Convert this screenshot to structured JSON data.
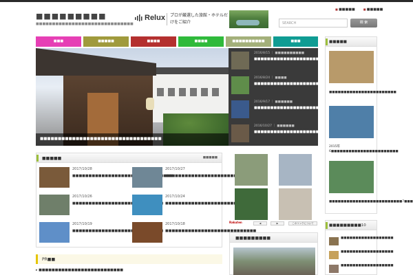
{
  "site": {
    "title": "■■■■■■■■■",
    "subtitle": "■■■■■■■■■■■■■■■■■■■■■■■■■■■■■■"
  },
  "banner": {
    "brand": "Relux",
    "tagline": "プロが厳選した旅館・ホテルだけをご紹介"
  },
  "toplinks": [
    "■■■■■",
    "■■■■■"
  ],
  "search": {
    "placeholder": "SEARCH",
    "button": "検 索"
  },
  "nav": [
    {
      "label": "■■■",
      "color": "#e63fb5"
    },
    {
      "label": "■■■■■",
      "color": "#a09a3c"
    },
    {
      "label": "■■■■",
      "color": "#b4302f"
    },
    {
      "label": "■■■■",
      "color": "#2fba3b"
    },
    {
      "label": "■■■■■■■■■■",
      "color": "#a3b07a"
    },
    {
      "label": "■■■",
      "color": "#0f9c93"
    }
  ],
  "hero": {
    "caption": "■■■■■■■■■■■■■■■■■■■■■■■■■■■■■■■■■■"
  },
  "slider": [
    {
      "meta": "2016/8/15 ｜ ■■■■■■■■■■",
      "title": "■■■■■■■■■■■■■■■■■■■■■■■■■■■■■■■■■",
      "color": "#6f6a55"
    },
    {
      "meta": "2016/8/24 ｜ ■■■■",
      "title": "■■■■■■■■■■■■■■■■■■■■■■■■■■■■■■■■■",
      "color": "#5f8d4a"
    },
    {
      "meta": "2016/9/17 ｜ ■■■■■■",
      "title": "■■■■■■■■■■■■■■■■■■■■■■■■■■■■■■■■■",
      "color": "#3a5a8c"
    },
    {
      "meta": "2016/10/27 ｜ ■■■■■■",
      "title": "■■■■■■■■■■■■■■■■■■■■■■■■■■■■■■■■■",
      "color": "#6a5a48"
    }
  ],
  "new_posts": {
    "heading": "■■■■■",
    "more": "■■■■■",
    "entries": [
      {
        "date": "2017/10/28",
        "title": "■■■■■■■■■■■■■■■■■■■■■■■■■■■■■■■",
        "color": "#7a5a3a"
      },
      {
        "date": "2017/10/27",
        "title": "■■■■■■■■■■■■■■■■■■■■■■■■■■",
        "color": "#6f8796"
      },
      {
        "date": "2017/10/26",
        "title": "■■■■■■■■■■■■■■■■■■■■■■■■■■■■",
        "color": "#6f7f6a"
      },
      {
        "date": "2017/10/24",
        "title": "■■■■■■■■■■■■■■■■■■■■■■■■■■■■",
        "color": "#3f8fbf"
      },
      {
        "date": "2017/10/19",
        "title": "■■■■■■■■■■■■■■■■■■■■■■■■■■■■",
        "color": "#5f8fc8"
      },
      {
        "date": "2017/10/18",
        "title": "■■■■■■■■■■■■■■■■■■■■■■■■■■■■",
        "color": "#7a4a2a"
      }
    ]
  },
  "pr": {
    "heading": "PR■■",
    "link": "■■■■■■■■■■■■■■■■■■■■■■■■■■"
  },
  "rakuten": {
    "logo": "Rakuten",
    "buttons": [
      "◀",
      "▶",
      "このリンクについて"
    ],
    "images": [
      "#8b9c7a",
      "#a7b5c4",
      "#3f6a3a",
      "#c8c0b3"
    ]
  },
  "side_panel": {
    "heading": "■■■■■■■■■"
  },
  "right_col": {
    "heading": "■■■■■",
    "items": [
      {
        "text": "■■■■■■■■■■■■■■■■■■■■■■■",
        "color": "#b89a6a"
      },
      {
        "text": "2015年6■■■■■■■■■■■■■■■■■■■■■■■",
        "color": "#4f7fa8"
      },
      {
        "text": "■■■■■■■■■■■■■■■■■■■■■■■■■7■■■■■",
        "color": "#5b8b5a"
      }
    ]
  },
  "rank": {
    "heading": "■■■■■■■■■10",
    "items": [
      {
        "text": "■■■■■■■■■■■■■■■■■■",
        "color": "#8a7350"
      },
      {
        "text": "■■■■■■■■■■■■■■■■■■",
        "color": "#c6a15a"
      },
      {
        "text": "■■■■■■■■■■■■■■■■■■",
        "color": "#8d7868"
      }
    ]
  }
}
